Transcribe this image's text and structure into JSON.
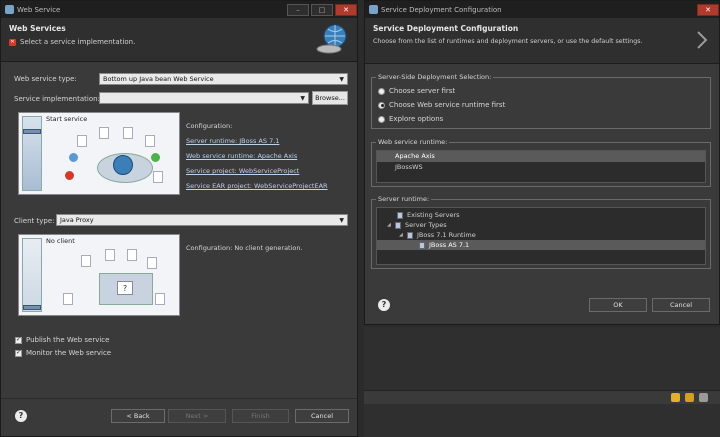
{
  "left_window": {
    "title": "Web Service",
    "header_title": "Web Services",
    "header_message": "Select a service implementation.",
    "service_type_label": "Web service type:",
    "service_type_value": "Bottom up Java bean Web Service",
    "service_impl_label": "Service implementation:",
    "service_impl_value": "",
    "browse_label": "Browse...",
    "service_panel_title": "Start service",
    "configuration_title": "Configuration:",
    "config_links": [
      "Server runtime: JBoss AS 7.1",
      "Web service runtime: Apache Axis",
      "Service project: WebServiceProject",
      "Service EAR project: WebServiceProjectEAR"
    ],
    "client_type_label": "Client type:",
    "client_type_value": "Java Proxy",
    "client_panel_title": "No client",
    "client_config_text": "Configuration: No client generation.",
    "publish_label": "Publish the Web service",
    "monitor_label": "Monitor the Web service",
    "back_label": "< Back",
    "next_label": "Next >",
    "finish_label": "Finish",
    "cancel_label": "Cancel"
  },
  "right_window": {
    "title": "Service Deployment Configuration",
    "header_title": "Service Deployment Configuration",
    "header_message": "Choose from the list of runtimes and deployment servers, or use the default settings.",
    "server_side_group": "Server-Side Deployment Selection:",
    "radio_options": [
      "Choose server first",
      "Choose Web service runtime first",
      "Explore options"
    ],
    "selected_radio": 1,
    "ws_runtime_group": "Web service runtime:",
    "ws_runtimes": [
      "Apache Axis",
      "JBossWS"
    ],
    "server_runtime_group": "Server runtime:",
    "server_tree": [
      "Existing Servers",
      "Server Types",
      "JBoss 7.1 Runtime",
      "JBoss AS 7.1"
    ],
    "ok_label": "OK",
    "cancel_label": "Cancel"
  },
  "colors": {
    "window_bg": "#3a3a3a",
    "titlebar_bg": "#1f1f1f",
    "link_color": "#bcd3ee",
    "error_red": "#d23a2a"
  }
}
